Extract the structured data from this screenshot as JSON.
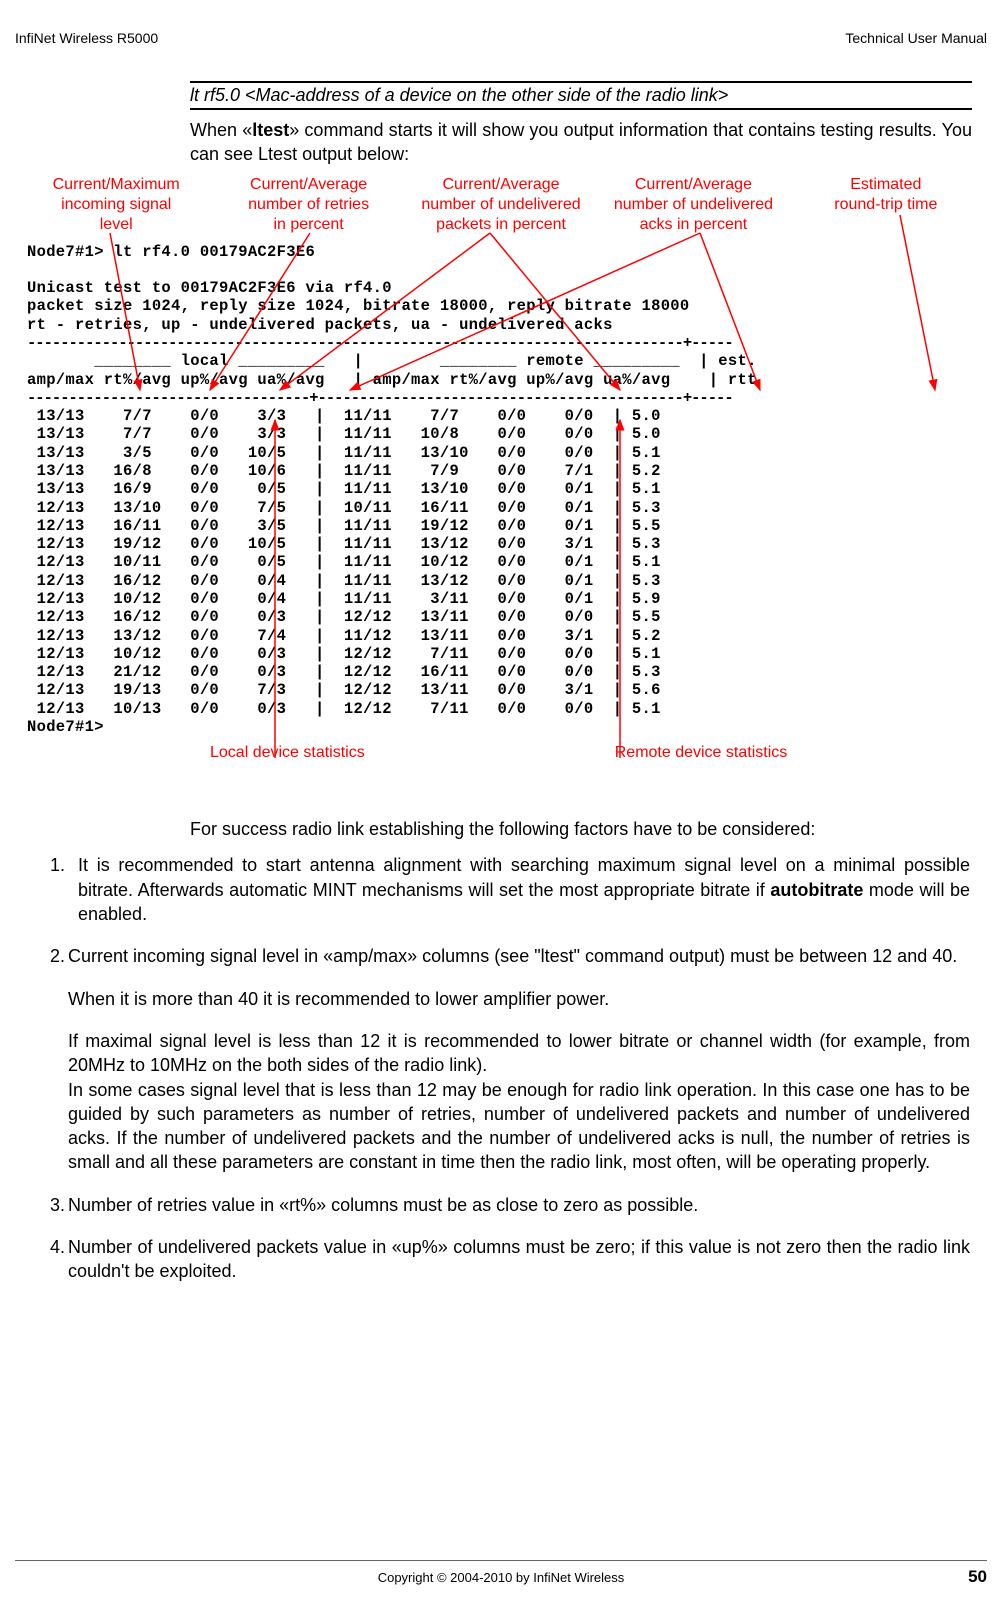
{
  "header": {
    "left": "InfiNet Wireless R5000",
    "right": "Technical User Manual"
  },
  "command_syntax": "lt rf5.0 <Mac-address of a device on the other side of the radio link>",
  "intro_prefix": "When «",
  "intro_bold": "ltest",
  "intro_suffix": "» command starts it will show you output information that contains testing results. You can see Ltest output below:",
  "annotations": {
    "a1_l1": "Current/Maximum",
    "a1_l2": "incoming signal",
    "a1_l3": "level",
    "a2_l1": "Current/Average",
    "a2_l2": "number of retries",
    "a2_l3": "in percent",
    "a3_l1": "Current/Average",
    "a3_l2": "number of undelivered",
    "a3_l3": "packets in percent",
    "a4_l1": "Current/Average",
    "a4_l2": "number of undelivered",
    "a4_l3": "acks in percent",
    "a5_l1": "Estimated",
    "a5_l2": "round-trip time"
  },
  "terminal": {
    "l1": "Node7#1> lt rf4.0 00179AC2F3E6",
    "l2": " ",
    "l3": "Unicast test to 00179AC2F3E6 via rf4.0",
    "l4": "packet size 1024, reply size 1024, bitrate 18000, reply bitrate 18000",
    "l5": "rt - retries, up - undelivered packets, ua - undelivered acks",
    "sep1": "-------------------------------------------------------------------------------+-----",
    "h1": "       ________ local _________   |        ________ remote _________  | est.",
    "h2": "amp/max rt%/avg up%/avg ua%/avg   | amp/max rt%/avg up%/avg ua%/avg    | rtt",
    "sep2": "----------------------------------+--------------------------------------------+-----",
    "r1": " 13/13    7/7    0/0    3/3   |  11/11    7/7    0/0    0/0  | 5.0",
    "r2": " 13/13    7/7    0/0    3/3   |  11/11   10/8    0/0    0/0  | 5.0",
    "r3": " 13/13    3/5    0/0   10/5   |  11/11   13/10   0/0    0/0  | 5.1",
    "r4": " 13/13   16/8    0/0   10/6   |  11/11    7/9    0/0    7/1  | 5.2",
    "r5": " 13/13   16/9    0/0    0/5   |  11/11   13/10   0/0    0/1  | 5.1",
    "r6": " 12/13   13/10   0/0    7/5   |  10/11   16/11   0/0    0/1  | 5.3",
    "r7": " 12/13   16/11   0/0    3/5   |  11/11   19/12   0/0    0/1  | 5.5",
    "r8": " 12/13   19/12   0/0   10/5   |  11/11   13/12   0/0    3/1  | 5.3",
    "r9": " 12/13   10/11   0/0    0/5   |  11/11   10/12   0/0    0/1  | 5.1",
    "r10": " 12/13   16/12   0/0    0/4   |  11/11   13/12   0/0    0/1  | 5.3",
    "r11": " 12/13   10/12   0/0    0/4   |  11/11    3/11   0/0    0/1  | 5.9",
    "r12": " 12/13   16/12   0/0    0/3   |  12/12   13/11   0/0    0/0  | 5.5",
    "r13": " 12/13   13/12   0/0    7/4   |  11/12   13/11   0/0    3/1  | 5.2",
    "r14": " 12/13   10/12   0/0    0/3   |  12/12    7/11   0/0    0/0  | 5.1",
    "r15": " 12/13   21/12   0/0    0/3   |  12/12   16/11   0/0    0/0  | 5.3",
    "r16": " 12/13   19/13   0/0    7/3   |  12/12   13/11   0/0    3/1  | 5.6",
    "r17": " 12/13   10/13   0/0    0/3   |  12/12    7/11   0/0    0/0  | 5.1",
    "l_end": "Node7#1>"
  },
  "bottom_ann": {
    "local": "Local device statistics",
    "remote": "Remote device statistics"
  },
  "para_intro": "For success radio link establishing the following factors have to be considered:",
  "item1_num": "1.",
  "item1_prefix": "It is recommended to start antenna alignment with searching maximum signal level on a minimal possible bitrate.  Afterwards automatic MINT mechanisms will set the most appropriate bitrate if ",
  "item1_bold": "autobitrate",
  "item1_suffix": " mode will be enabled.",
  "item2_num": "2.",
  "item2_p1": "Current incoming signal level in «amp/max» columns (see \"ltest\" command output) must be between 12 and 40.",
  "item2_p2": "When it is more than 40 it is recommended to lower amplifier power.",
  "item2_p3": "If maximal signal level is less than 12 it is recommended to lower bitrate or channel width (for example, from 20MHz to 10MHz on the both sides of the radio link).",
  "item2_p4": "In some cases signal level that is less than 12 may be enough for radio link operation. In this case one has to be guided by such parameters as number of retries, number of undelivered packets and number of undelivered acks. If the number of undelivered packets and the number of undelivered acks is null, the number of retries is small and all these parameters are constant in time then the radio link, most often, will be operating properly.",
  "item3_num": "3.",
  "item3": "Number of retries value in «rt%» columns must be as close to zero as possible.",
  "item4_num": "4.",
  "item4": "Number of undelivered packets value in «up%» columns must be zero; if this value is not zero then the radio link couldn't be exploited.",
  "footer": {
    "copyright": "Copyright © 2004-2010 by InfiNet Wireless",
    "page": "50"
  }
}
